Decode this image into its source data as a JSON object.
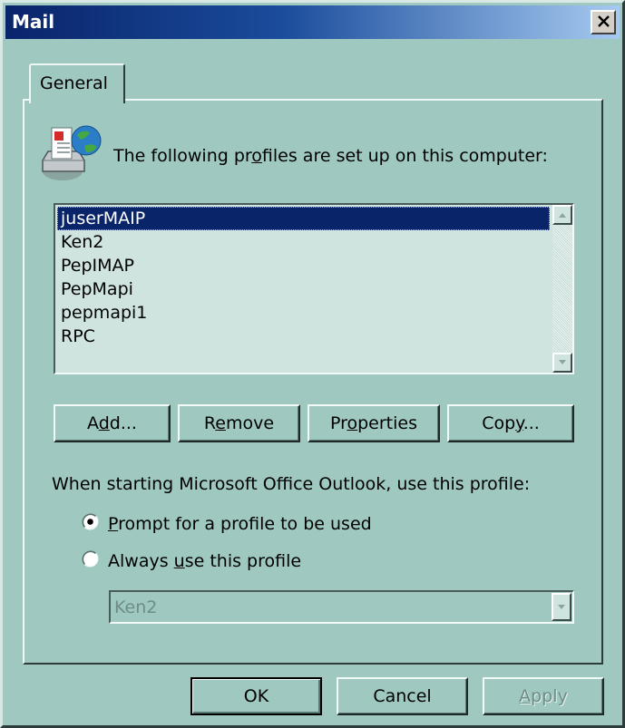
{
  "window": {
    "title": "Mail"
  },
  "tabs": [
    {
      "label": "General"
    }
  ],
  "profiles": {
    "label_before": "The following pr",
    "label_accel": "o",
    "label_after": "files are set up on this computer:",
    "items": [
      "juserMAIP",
      "Ken2",
      "PepIMAP",
      "PepMapi",
      "pepmapi1",
      "RPC"
    ],
    "selected": "juserMAIP"
  },
  "actions": {
    "add": {
      "before": "A",
      "accel": "d",
      "after": "d..."
    },
    "remove": {
      "before": "R",
      "accel": "e",
      "after": "move"
    },
    "properties": {
      "before": "Pr",
      "accel": "o",
      "after": "perties"
    },
    "copy": {
      "before": "Cop",
      "accel": "y",
      "after": "..."
    }
  },
  "startup": {
    "label": "When starting Microsoft Office Outlook, use this profile:",
    "prompt": {
      "accel": "P",
      "after": "rompt for a profile to be used",
      "checked": true
    },
    "always": {
      "before": "Always ",
      "accel": "u",
      "after": "se this profile",
      "checked": false
    },
    "selected_profile": "Ken2"
  },
  "footer": {
    "ok": "OK",
    "cancel": "Cancel",
    "apply_accel": "A",
    "apply_after": "pply"
  },
  "icons": [
    "mail-profiles-icon",
    "close-icon",
    "scroll-up-arrow-icon",
    "scroll-down-arrow-icon",
    "combo-dropdown-arrow-icon",
    "radio-checked-icon",
    "radio-unchecked-icon"
  ],
  "colors": {
    "face": "#9ec8c0",
    "titlebar": "#0a246a",
    "selection": "#0a246a",
    "list_background": "#cfe4df"
  }
}
